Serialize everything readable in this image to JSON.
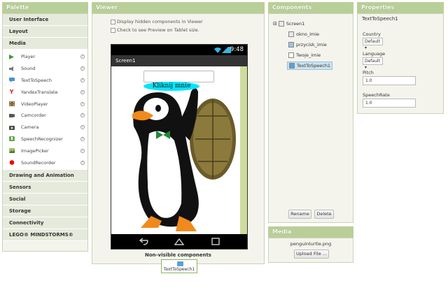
{
  "palette": {
    "title": "Palette",
    "categories_top": [
      "User Interface",
      "Layout",
      "Media"
    ],
    "media_items": [
      {
        "label": "Player",
        "icon": "play-icon"
      },
      {
        "label": "Sound",
        "icon": "speaker-icon"
      },
      {
        "label": "TextToSpeech",
        "icon": "speech-bubble-icon"
      },
      {
        "label": "YandexTranslate",
        "icon": "yandex-icon"
      },
      {
        "label": "VideoPlayer",
        "icon": "film-icon"
      },
      {
        "label": "Camcorder",
        "icon": "camcorder-icon"
      },
      {
        "label": "Camera",
        "icon": "camera-icon"
      },
      {
        "label": "SpeechRecognizer",
        "icon": "microphone-icon"
      },
      {
        "label": "ImagePicker",
        "icon": "picture-icon"
      },
      {
        "label": "SoundRecorder",
        "icon": "record-icon"
      }
    ],
    "help_glyph": "?",
    "categories_bottom": [
      "Drawing and Animation",
      "Sensors",
      "Social",
      "Storage",
      "Connectivity",
      "LEGO® MINDSTORMS®"
    ]
  },
  "viewer": {
    "title": "Viewer",
    "checkbox_hidden": "Display hidden components in Viewer",
    "checkbox_tablet": "Check to see Preview on Tablet size.",
    "phone": {
      "time": "9:48",
      "screen_title": "Screen1",
      "bubble_text": "Kliknij mnie"
    },
    "nonvisible_title": "Non-visible components",
    "nonvisible_item": "TextToSpeech1"
  },
  "components": {
    "title": "Components",
    "tree": {
      "root": "Screen1",
      "children": [
        "okno_imie",
        "przycisk_imie",
        "Twoje_imie",
        "TextToSpeech1"
      ]
    },
    "rename_label": "Rename",
    "delete_label": "Delete"
  },
  "media": {
    "title": "Media",
    "file": "penguinturtle.png",
    "upload_label": "Upload File ..."
  },
  "properties": {
    "title": "Properties",
    "component": "TextToSpeech1",
    "country_label": "Country",
    "country_value": "Default ▾",
    "language_label": "Language",
    "language_value": "Default ▾",
    "pitch_label": "Pitch",
    "pitch_value": "1.0",
    "speechrate_label": "SpeechRate",
    "speechrate_value": "1.0"
  },
  "colors": {
    "header_green": "#b9cf99",
    "accent_cyan": "#00e5ff",
    "selected_blue": "#cde3f0"
  }
}
